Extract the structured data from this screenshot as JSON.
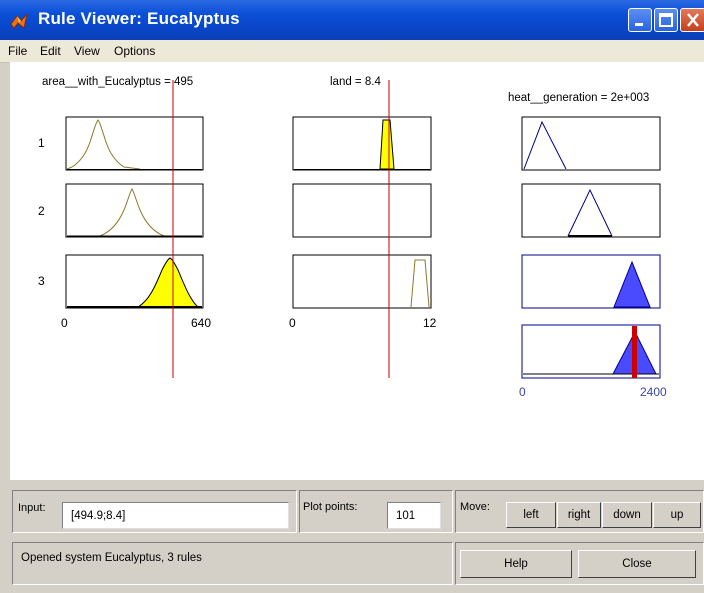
{
  "window": {
    "title": "Rule Viewer: Eucalyptus",
    "accent": "#0a4fd8"
  },
  "menu": [
    "File",
    "Edit",
    "View",
    "Options"
  ],
  "plots": {
    "input1": {
      "title": "area__with_Eucalyptus = 495",
      "tick_min": "0",
      "tick_max": "640"
    },
    "input2": {
      "title": "land = 8.4",
      "tick_min": "0",
      "tick_max": "12"
    },
    "output": {
      "title": "heat__generation = 2e+003",
      "tick_min": "0",
      "tick_max": "2400"
    },
    "rules": [
      "1",
      "2",
      "3"
    ],
    "colors": {
      "input_curve": "#8a7a2a",
      "input_fill": "#ffff00",
      "output_fill": "#4a4aff",
      "output_line": "#00008b",
      "marker": "#cc0000"
    }
  },
  "controls": {
    "input_label": "Input:",
    "input_value": "[494.9;8.4]",
    "plot_points_label": "Plot points:",
    "plot_points_value": "101",
    "move_label": "Move:",
    "move_buttons": [
      "left",
      "right",
      "down",
      "up"
    ],
    "status": "Opened system Eucalyptus, 3 rules",
    "help": "Help",
    "close": "Close"
  }
}
